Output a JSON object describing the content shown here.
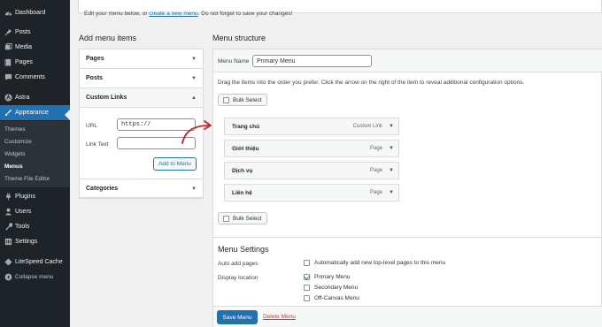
{
  "sidebar": {
    "items": [
      {
        "label": "Dashboard",
        "icon": "dashboard-icon"
      },
      {
        "label": "Posts",
        "icon": "pin-icon"
      },
      {
        "label": "Media",
        "icon": "media-icon"
      },
      {
        "label": "Pages",
        "icon": "page-icon"
      },
      {
        "label": "Comments",
        "icon": "comment-icon"
      },
      {
        "label": "Astra",
        "icon": "astra-icon"
      },
      {
        "label": "Appearance",
        "icon": "brush-icon"
      },
      {
        "label": "Plugins",
        "icon": "plug-icon"
      },
      {
        "label": "Users",
        "icon": "user-icon"
      },
      {
        "label": "Tools",
        "icon": "wrench-icon"
      },
      {
        "label": "Settings",
        "icon": "settings-icon"
      },
      {
        "label": "LiteSpeed Cache",
        "icon": "diamond-icon"
      },
      {
        "label": "Collapse menu",
        "icon": "collapse-icon"
      }
    ],
    "submenu": [
      "Themes",
      "Customize",
      "Widgets",
      "Menus",
      "Theme File Editor"
    ],
    "active_color": "#2271b1"
  },
  "notice": {
    "text_before": "Edit your menu below, or ",
    "link": "create a new menu",
    "text_after": ". Do not forget to save your changes!"
  },
  "add_items": {
    "title": "Add menu items",
    "sections": [
      "Pages",
      "Posts",
      "Custom Links",
      "Categories"
    ],
    "url_label": "URL",
    "url_value": "https://",
    "link_text_label": "Link Text",
    "link_text_value": "",
    "add_button": "Add to Menu"
  },
  "structure": {
    "title": "Menu structure",
    "menu_name_label": "Menu Name",
    "menu_name_value": "Primary Menu",
    "instructions": "Drag the items into the order you prefer. Click the arrow on the right of the item to reveal additional configuration options.",
    "bulk_select": "Bulk Select",
    "items": [
      {
        "title": "Trang chủ",
        "type": "Custom Link"
      },
      {
        "title": "Giới thiệu",
        "type": "Page"
      },
      {
        "title": "Dịch vụ",
        "type": "Page"
      },
      {
        "title": "Liên hệ",
        "type": "Page"
      }
    ]
  },
  "settings": {
    "title": "Menu Settings",
    "auto_add_label": "Auto add pages",
    "auto_add_option": "Automatically add new top-level pages to this menu",
    "display_location_label": "Display location",
    "locations": [
      {
        "label": "Primary Menu",
        "checked": true
      },
      {
        "label": "Secondary Menu",
        "checked": false
      },
      {
        "label": "Off-Canvas Menu",
        "checked": false
      }
    ]
  },
  "footer": {
    "save": "Save Menu",
    "delete": "Delete Menu"
  },
  "colors": {
    "accent": "#2271b1",
    "annotation_arrow": "#c0282d",
    "delete": "#d63638"
  }
}
